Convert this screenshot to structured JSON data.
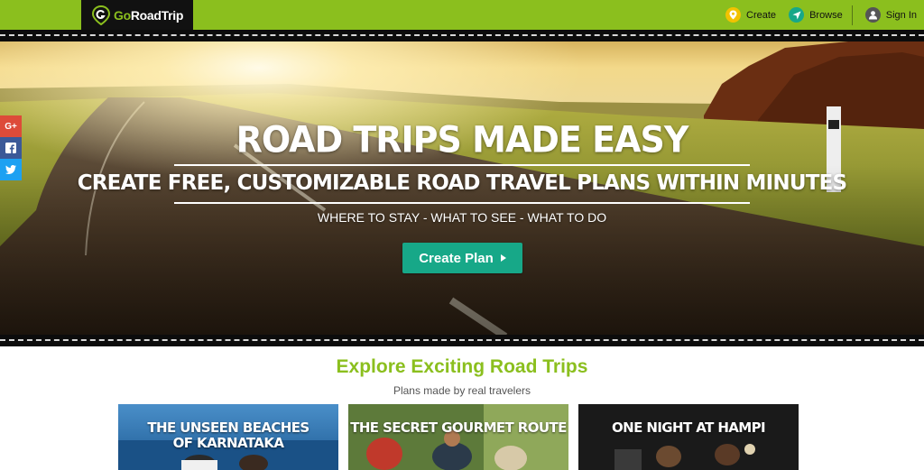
{
  "brand": {
    "go": "Go",
    "roadtrip": "RoadTrip"
  },
  "nav": [
    {
      "label": "Create",
      "icon": "map-pin-icon"
    },
    {
      "label": "Browse",
      "icon": "navigate-icon"
    },
    {
      "label": "Sign In",
      "icon": "user-icon"
    }
  ],
  "hero": {
    "title": "ROAD TRIPS MADE EASY",
    "subtitle": "CREATE FREE, CUSTOMIZABLE ROAD TRAVEL PLANS WITHIN MINUTES",
    "tagline": "WHERE TO STAY - WHAT TO SEE - WHAT TO DO",
    "cta_label": "Create Plan"
  },
  "social": [
    {
      "label": "G+",
      "icon": "google-plus-icon",
      "color": "#dd4b39"
    },
    {
      "label": "f",
      "icon": "facebook-icon",
      "color": "#3b5998"
    },
    {
      "label": "t",
      "icon": "twitter-icon",
      "color": "#1da1f2"
    }
  ],
  "explore": {
    "title": "Explore Exciting Road Trips",
    "subtitle": "Plans made by real travelers"
  },
  "cards": [
    {
      "title_line1": "THE UNSEEN BEACHES",
      "title_line2": "OF KARNATAKA"
    },
    {
      "title_line1": "THE SECRET GOURMET ROUTE",
      "title_line2": ""
    },
    {
      "title_line1": "ONE NIGHT AT HAMPI",
      "title_line2": ""
    }
  ],
  "colors": {
    "brand_green": "#8bbf1e",
    "cta_teal": "#17a888",
    "logo_bg": "#111111"
  }
}
